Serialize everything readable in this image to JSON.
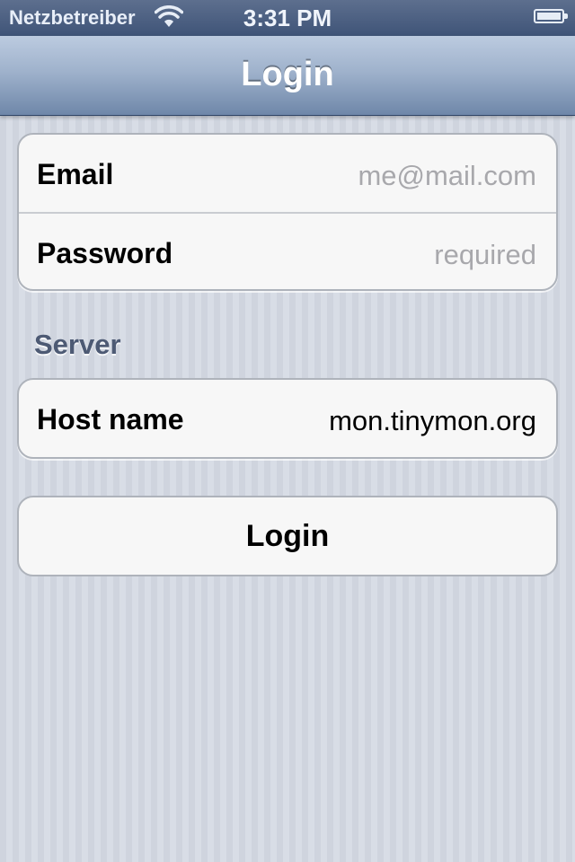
{
  "status_bar": {
    "carrier": "Netzbetreiber",
    "time": "3:31 PM",
    "wifi_icon": "wifi-icon",
    "battery_icon": "battery-icon"
  },
  "nav": {
    "title": "Login"
  },
  "credentials": {
    "email_label": "Email",
    "email_placeholder": "me@mail.com",
    "password_label": "Password",
    "password_placeholder": "required"
  },
  "server": {
    "section_title": "Server",
    "host_label": "Host name",
    "host_value": "mon.tinymon.org"
  },
  "actions": {
    "login_label": "Login"
  },
  "colors": {
    "nav_bar": "#9fb2cc",
    "status_bar": "#3f5478",
    "background": "#d3d8e1",
    "section_header": "#4d5a74",
    "placeholder": "#a8a8ac"
  }
}
